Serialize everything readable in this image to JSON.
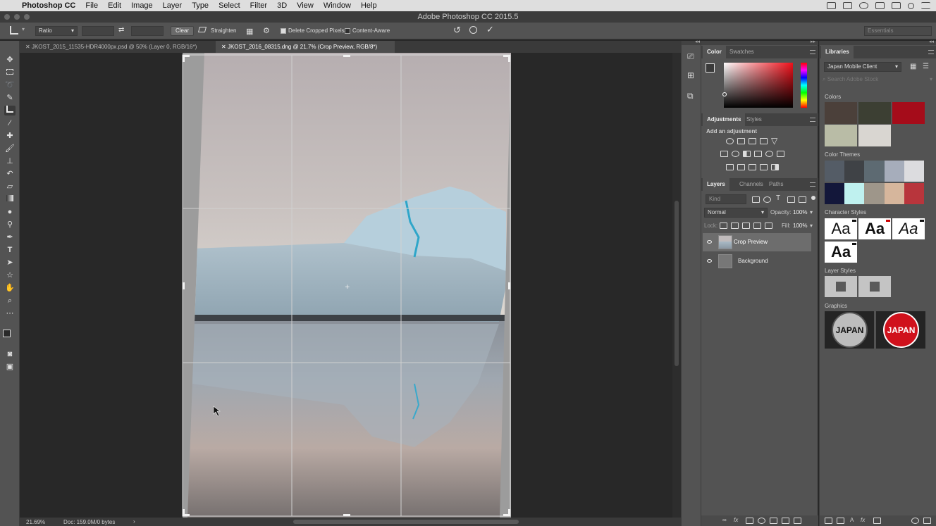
{
  "menubar": {
    "app_name": "Photoshop CC",
    "items": [
      "File",
      "Edit",
      "Image",
      "Layer",
      "Type",
      "Select",
      "Filter",
      "3D",
      "View",
      "Window",
      "Help"
    ]
  },
  "titlebar": {
    "title": "Adobe Photoshop CC 2015.5"
  },
  "options": {
    "ratio": "Ratio",
    "clear": "Clear",
    "straighten": "Straighten",
    "delete_cropped": "Delete Cropped Pixels",
    "content_aware": "Content-Aware",
    "workspace": "Essentials"
  },
  "tabs": [
    {
      "label": "JKOST_2015_11535-HDR4000px.psd @ 50% (Layer 0, RGB/16*)"
    },
    {
      "label": "JKOST_2016_08315.dng @ 21.7% (Crop Preview, RGB/8*)"
    }
  ],
  "status": {
    "zoom": "21.69%",
    "doc": "Doc: 159.0M/0 bytes"
  },
  "color_panel": {
    "tabs": [
      "Color",
      "Swatches"
    ]
  },
  "adjustments": {
    "tabs": [
      "Adjustments",
      "Styles"
    ],
    "hint": "Add an adjustment"
  },
  "layers_panel": {
    "tabs": [
      "Layers",
      "Channels",
      "Paths"
    ],
    "kind": "Kind",
    "blend": "Normal",
    "opacity_label": "Opacity:",
    "opacity": "100%",
    "lock_label": "Lock:",
    "fill_label": "Fill:",
    "fill": "100%",
    "layers": [
      {
        "name": "Crop Preview"
      },
      {
        "name": "Background"
      }
    ]
  },
  "libraries": {
    "title": "Libraries",
    "library": "Japan Mobile Client",
    "search_placeholder": "Search Adobe Stock",
    "colors_label": "Colors",
    "colors": [
      "#4b403a",
      "#3c3f33",
      "#a50c1a",
      "#b9bca6",
      "#d9d6d1"
    ],
    "themes_label": "Color Themes",
    "themes": [
      [
        "#545c66",
        "#3f4246",
        "#5d6a72",
        "#a6adbb",
        "#dcdcdf"
      ],
      [
        "#13173a",
        "#bff1ef",
        "#9e968a",
        "#d6b69c",
        "#b8353c"
      ]
    ],
    "char_styles_label": "Character Styles",
    "char_styles": [
      "Aa",
      "Aa",
      "Aa",
      "Aa"
    ],
    "layer_styles_label": "Layer Styles",
    "graphics_label": "Graphics",
    "graphics": [
      {
        "text": "JAPAN"
      },
      {
        "text": "JAPAN"
      }
    ]
  }
}
